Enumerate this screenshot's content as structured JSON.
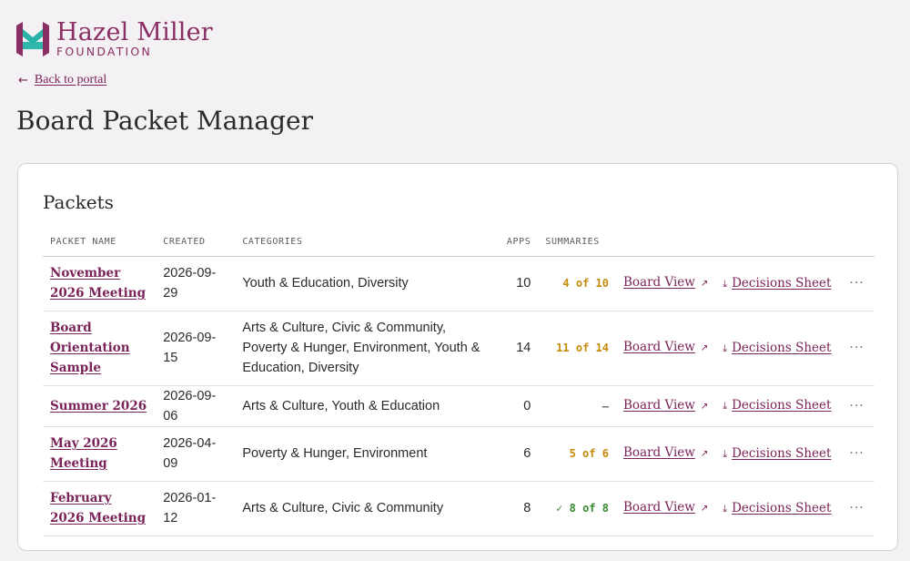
{
  "brand": {
    "name": "Hazel Miller",
    "subtitle": "FOUNDATION",
    "colors": {
      "plum": "#8a2f63",
      "teal": "#27b3a8"
    }
  },
  "nav": {
    "back_icon": "arrow-left-icon",
    "back_label": "Back to portal"
  },
  "page": {
    "title": "Board Packet Manager"
  },
  "packets": {
    "heading": "Packets",
    "columns": {
      "name": "PACKET NAME",
      "created": "CREATED",
      "categories": "CATEGORIES",
      "apps": "APPS",
      "summaries": "SUMMARIES"
    },
    "board_view_label": "Board View",
    "decisions_label": "Decisions Sheet",
    "more_label": "···",
    "rows": [
      {
        "name": "November 2026 Meeting",
        "created": "2026-09-29",
        "categories": "Youth & Education, Diversity",
        "apps": "10",
        "summaries": "4 of 10",
        "status": "partial"
      },
      {
        "name": "Board Orientation Sample",
        "created": "2026-09-15",
        "categories": "Arts & Culture, Civic & Community, Poverty & Hunger, Environment, Youth & Education, Diversity",
        "apps": "14",
        "summaries": "11 of 14",
        "status": "partial"
      },
      {
        "name": "Summer 2026",
        "created": "2026-09-06",
        "categories": "Arts & Culture, Youth & Education",
        "apps": "0",
        "summaries": "—",
        "status": "none"
      },
      {
        "name": "May 2026 Meeting",
        "created": "2026-04-09",
        "categories": "Poverty & Hunger, Environment",
        "apps": "6",
        "summaries": "5 of 6",
        "status": "partial"
      },
      {
        "name": "February 2026 Meeting",
        "created": "2026-01-12",
        "categories": "Arts & Culture, Civic & Community",
        "apps": "8",
        "summaries": "✓ 8 of 8",
        "status": "complete"
      }
    ]
  }
}
